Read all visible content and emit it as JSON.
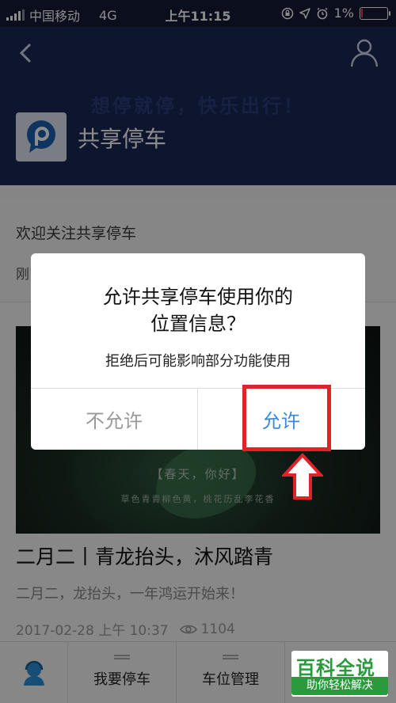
{
  "status_bar": {
    "carrier": "中国移动",
    "network": "4G",
    "time": "上午11:15",
    "battery_text": "1%",
    "battery_level": 0.05,
    "battery_color": "#e24a4a"
  },
  "header": {
    "slogan": "想停就停，快乐出行！",
    "brand_name": "共享停车",
    "back_icon": "chevron-left-icon",
    "user_icon": "user-icon"
  },
  "article_top": {
    "welcome": "欢迎关注共享停车",
    "second_line_partial": "刚"
  },
  "card": {
    "image_title": "【春天，你好】",
    "image_caption": "草色青青柳色黄，桃花历乱李花香",
    "title": "二月二丨青龙抬头，沐风踏青",
    "subtitle": "二月二，龙抬头，一年鸿运开始来！",
    "date": "2017-02-28 上午 10:37",
    "views": "1104"
  },
  "bottom_nav": {
    "items": [
      {
        "label": "",
        "icon": "service-agent-icon"
      },
      {
        "label": "我要停车"
      },
      {
        "label": "车位管理"
      }
    ]
  },
  "watermark": {
    "main": "百科全说",
    "sub": "助你轻松解决"
  },
  "dialog": {
    "title": "允许共享停车使用你的位置信息？",
    "title_line1": "允许共享停车使用你的",
    "title_line2": "位置信息？",
    "message": "拒绝后可能影响部分功能使用",
    "deny_label": "不允许",
    "allow_label": "允许"
  },
  "colors": {
    "header_bg": "#1b2756",
    "allow_blue": "#3b88e0",
    "annotation_red": "#e0222a",
    "watermark_green": "#2a9a3d"
  }
}
